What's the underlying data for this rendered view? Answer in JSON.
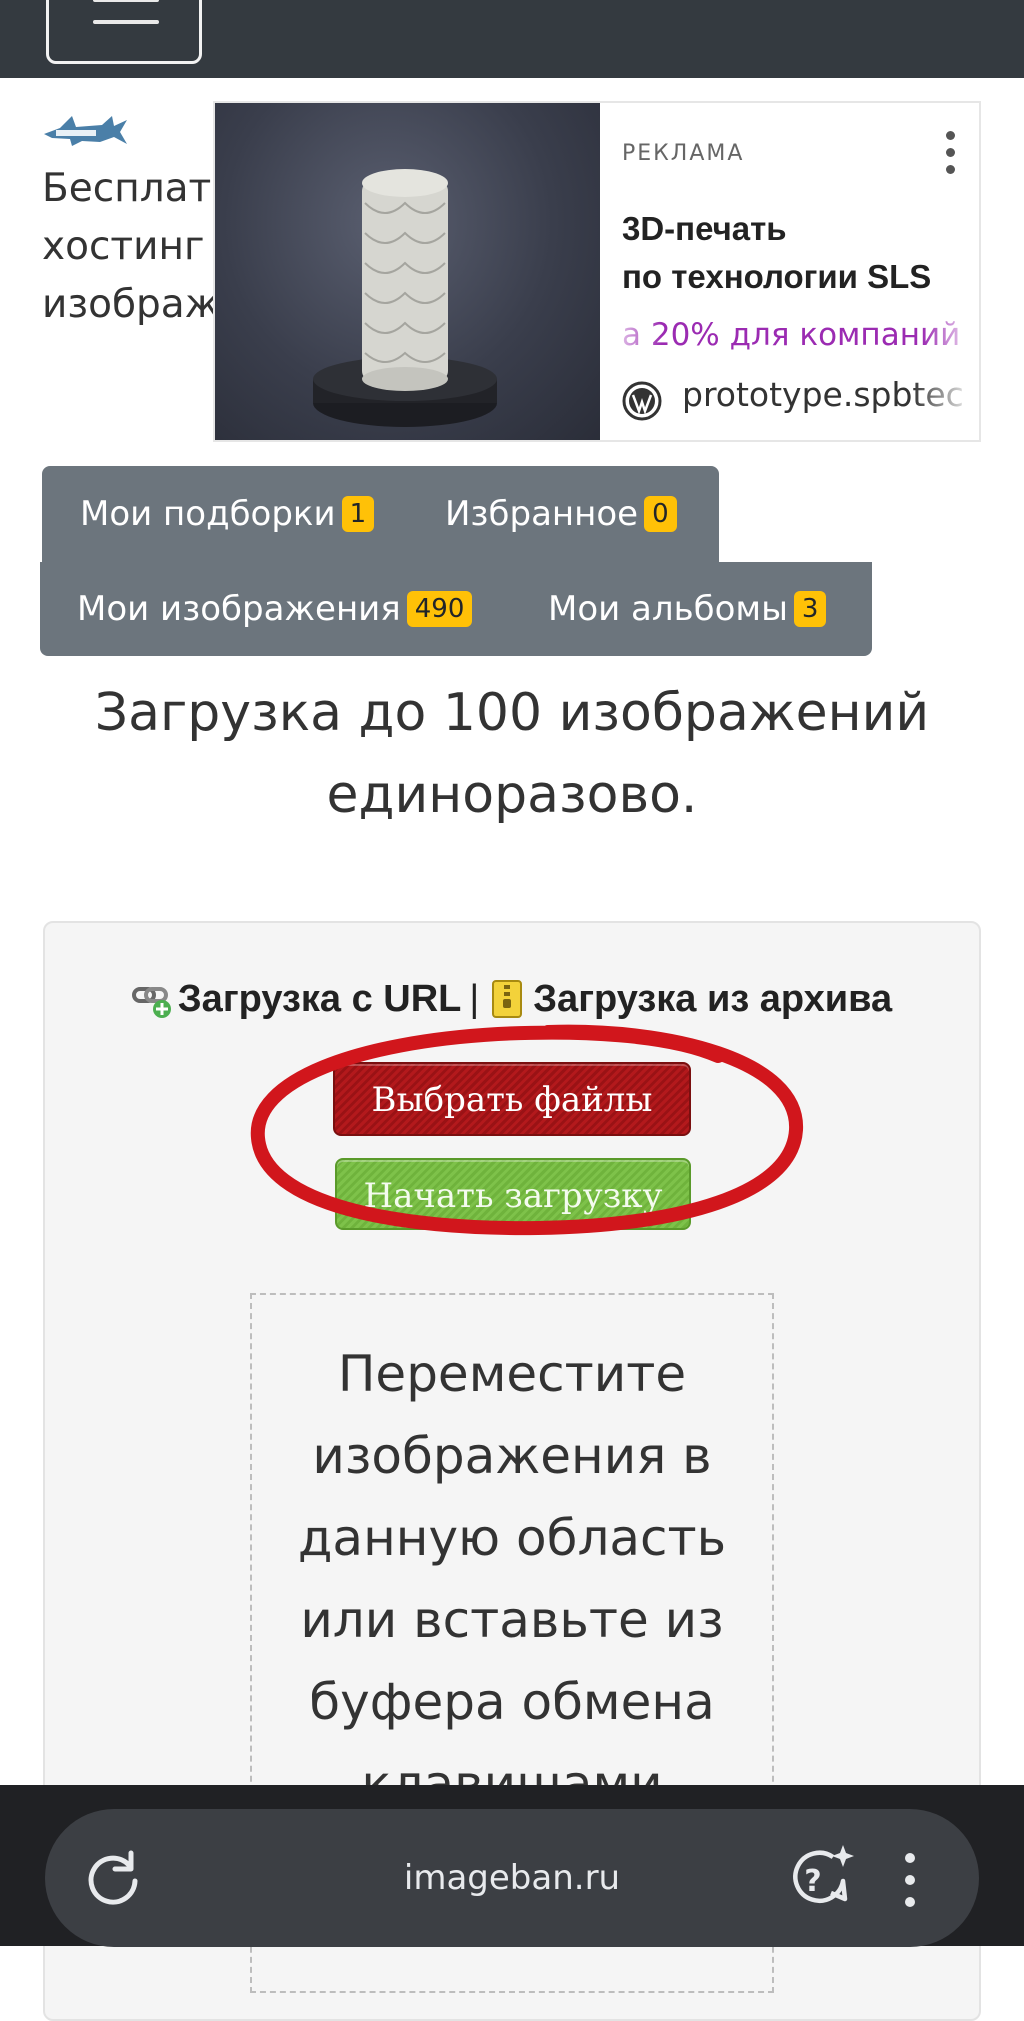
{
  "header": {
    "menu_icon": "hamburger-icon",
    "logo_icon": "shark-logo-icon",
    "tagline": "Бесплатн\nхостинг\nизображе"
  },
  "ad": {
    "label": "РЕКЛАМА",
    "title": "3D-печать\nпо технологии SLS",
    "promo": "а 20% для компаний",
    "site": "prototype.spbtec",
    "site_icon": "wordpress-icon",
    "menu_icon": "more-vert-icon",
    "promo_color": "#9b2bb2"
  },
  "tabs": [
    {
      "label": "Мои подборки",
      "count": "1"
    },
    {
      "label": "Избранное",
      "count": "0"
    },
    {
      "label": "Мои изображения",
      "count": "490"
    },
    {
      "label": "Мои альбомы",
      "count": "3"
    }
  ],
  "upload": {
    "heading": "Загрузка до 100 изображений единоразово.",
    "url_link": "Загрузка с URL",
    "separator": "|",
    "archive_link": "Загрузка из архива",
    "choose_button": "Выбрать файлы",
    "start_button": "Начать загрузку",
    "dropzone_text": "Переместите изображения в данную область или вставьте из буфера обмена клавишами"
  },
  "browser": {
    "url": "imageban.ru",
    "reload_icon": "reload-icon",
    "assistant_icon": "assistant-sparkle-icon",
    "menu_icon": "more-vert-icon"
  },
  "colors": {
    "navbar": "#343a40",
    "tab_bg": "#6c757d",
    "badge": "#ffc107",
    "choose_button": "#b3191c",
    "start_button": "#7ec24a",
    "annotation": "#d1161c"
  }
}
